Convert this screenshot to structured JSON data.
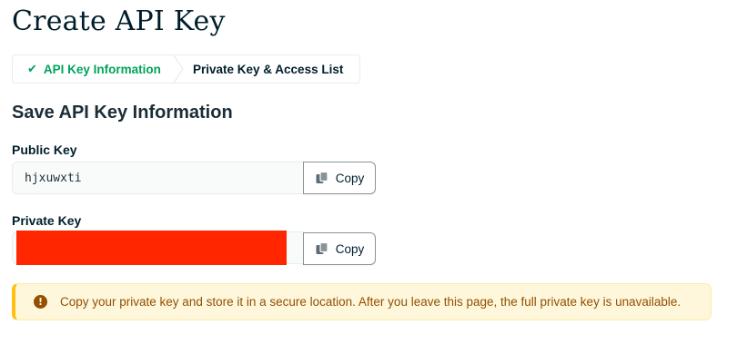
{
  "page": {
    "title": "Create API Key"
  },
  "steps": [
    {
      "label": "API Key Information",
      "icon": "check-icon",
      "state": "completed",
      "color": "#00a35c"
    },
    {
      "label": "Private Key & Access List",
      "state": "current"
    }
  ],
  "section": {
    "title": "Save API Key Information"
  },
  "public_key": {
    "label": "Public Key",
    "value": "hjxuwxti",
    "copy_label": "Copy"
  },
  "private_key": {
    "label": "Private Key",
    "value_redacted": true,
    "copy_label": "Copy"
  },
  "warning": {
    "icon": "warning-icon",
    "text": "Copy your private key and store it in a secure location. After you leave this page, the full private key is unavailable."
  },
  "colors": {
    "accent_green": "#00a35c",
    "warning_bg": "#fef7db",
    "warning_text": "#944f01",
    "redaction": "#ff2600"
  }
}
